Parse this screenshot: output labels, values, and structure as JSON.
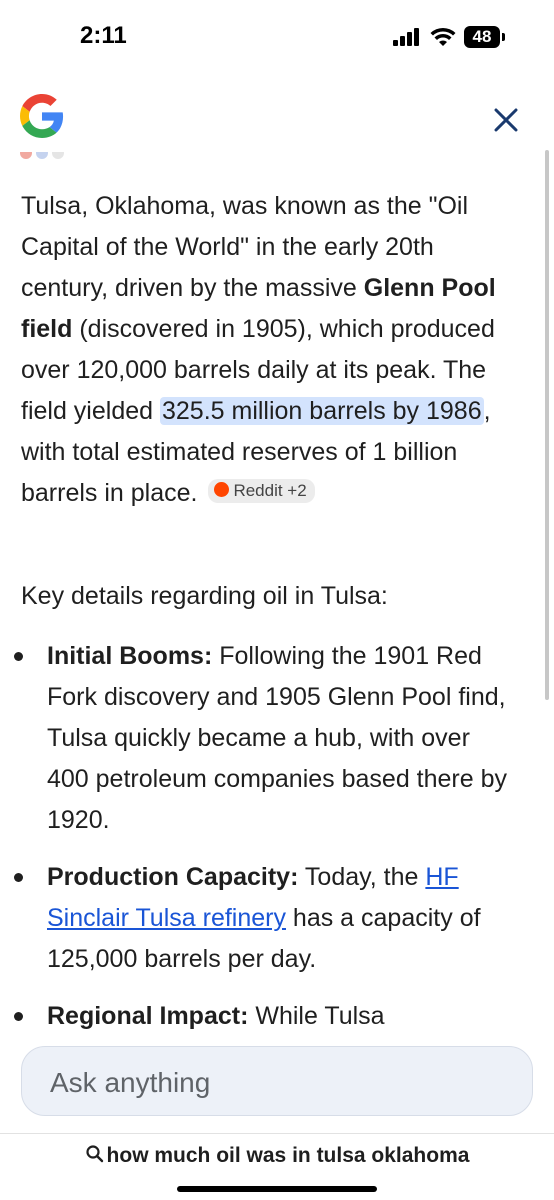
{
  "status_bar": {
    "time": "2:11",
    "battery": "48"
  },
  "header": {
    "logo": "google-g-logo",
    "close_icon": "close-icon"
  },
  "answer": {
    "p1_a": "Tulsa, Oklahoma, was known as the \"Oil Capital of the World\" in the early 20th century, driven by the massive ",
    "p1_b": "Glenn Pool field",
    "p1_c": " (discovered in 1905), which produced over 120,000 barrels daily at its peak. The field yielded ",
    "p1_d": "325.5 million barrels by 1986",
    "p1_e": ", with total estimated reserves of 1 billion barrels in place.",
    "source_chip": "Reddit +2",
    "key_details": "Key details regarding oil in Tulsa:",
    "bullets": [
      {
        "title": "Initial Booms:",
        "text": " Following the 1901 Red Fork discovery and 1905 Glenn Pool find, Tulsa quickly became a hub, with over 400 petroleum companies based there by 1920."
      },
      {
        "title": "Production Capacity:",
        "text_a": " Today, the ",
        "link": "HF Sinclair Tulsa refinery",
        "text_b": " has a capacity of 125,000 barrels per day."
      },
      {
        "title": "Regional Impact:",
        "text": " While Tulsa"
      }
    ]
  },
  "ask_bar": {
    "placeholder": "Ask anything"
  },
  "query": {
    "text": "how much oil was in tulsa oklahoma"
  }
}
